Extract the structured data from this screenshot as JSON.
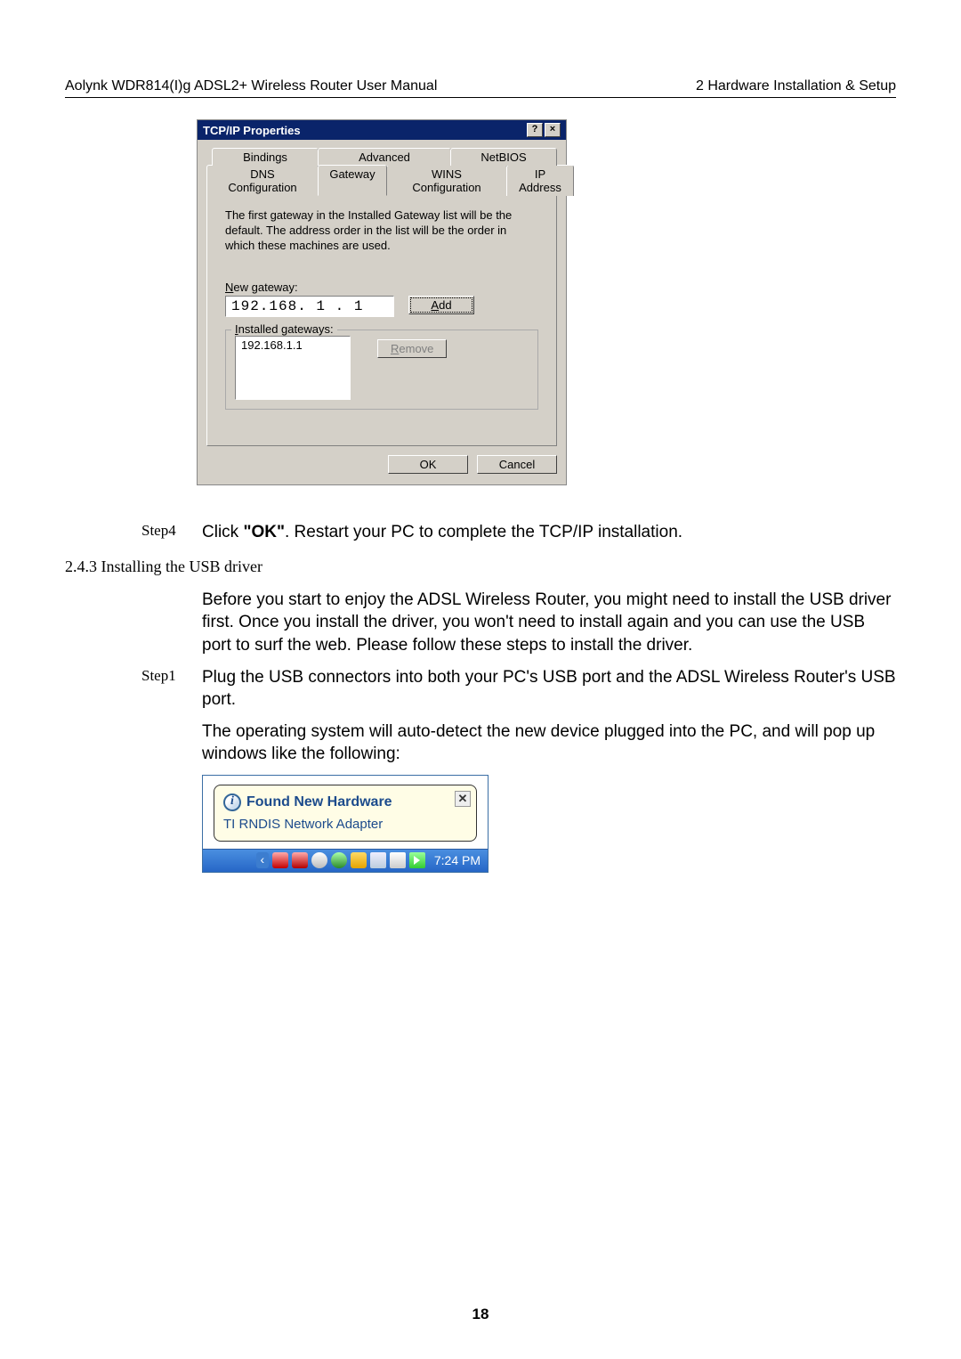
{
  "header": {
    "left": "Aolynk WDR814(I)g ADSL2+ Wireless Router User Manual",
    "right": "2 Hardware Installation & Setup"
  },
  "dialog": {
    "title": "TCP/IP Properties",
    "helpGlyph": "?",
    "closeGlyph": "×",
    "tabsTop": {
      "bindings": "Bindings",
      "advanced": "Advanced",
      "netbios": "NetBIOS"
    },
    "tabsBottom": {
      "dns": "DNS Configuration",
      "gateway": "Gateway",
      "wins": "WINS Configuration",
      "ip": "IP Address"
    },
    "desc": "The first gateway in the Installed Gateway list will be the default. The address order in the list will be the order in which these machines are used.",
    "newGatewayLabelPrefix": "N",
    "newGatewayLabelRest": "ew gateway:",
    "newGatewayValue": "192.168. 1 . 1",
    "addPrefix": "A",
    "addRest": "dd",
    "installedPrefix": "I",
    "installedRest": "nstalled gateways:",
    "listItem": "192.168.1.1",
    "removePrefix": "R",
    "removeRest": "emove",
    "ok": "OK",
    "cancel": "Cancel"
  },
  "step4": {
    "label": "Step4",
    "text_a": "Click ",
    "text_b": "\"OK\"",
    "text_c": ". Restart your PC to complete the TCP/IP installation."
  },
  "section": {
    "num": "2.4.3  Installing the USB driver"
  },
  "para1": "Before you start to enjoy the ADSL Wireless Router, you might need to install the USB driver first. Once you install the driver, you won't need to install again and you can use the USB port to surf the web. Please follow these steps to install the driver.",
  "step1": {
    "label": "Step1",
    "text": "Plug the USB connectors into both your PC's USB port and the ADSL Wireless Router's USB port."
  },
  "para2": "The operating system will auto-detect the new device plugged into the PC, and will pop up windows like the following:",
  "popup": {
    "title": "Found New Hardware",
    "sub": "TI RNDIS Network Adapter",
    "time": "7:24 PM"
  },
  "pageNum": "18"
}
